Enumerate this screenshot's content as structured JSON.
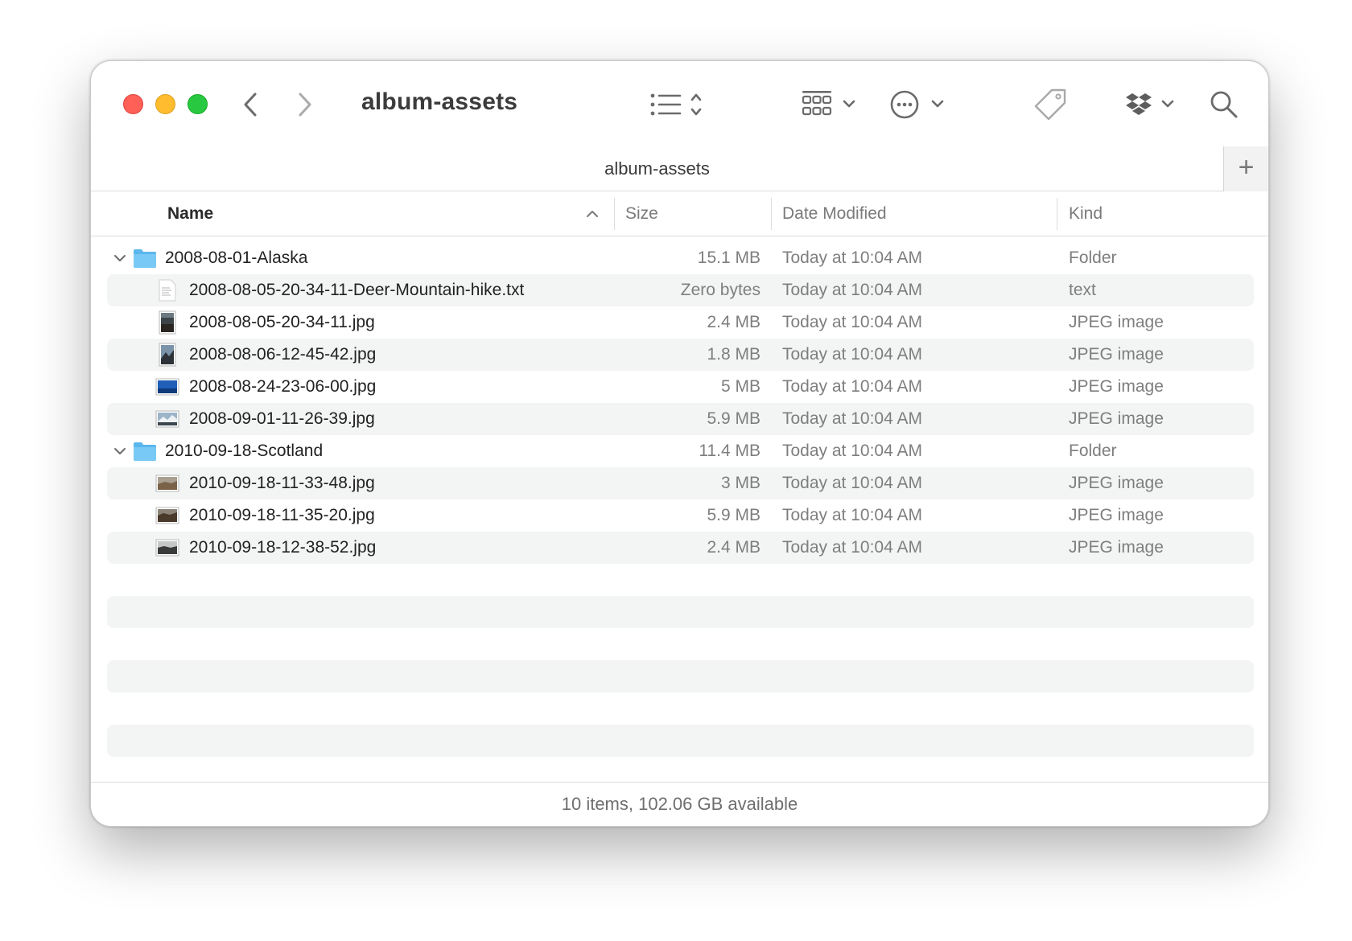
{
  "window": {
    "title": "album-assets",
    "path_title": "album-assets",
    "add_button": "+"
  },
  "toolbar": {
    "back_icon": "chevron-left-icon",
    "forward_icon": "chevron-right-icon",
    "view_icon": "list-view-icon",
    "group_icon": "grid-group-icon",
    "action_icon": "ellipsis-circle-icon",
    "tag_icon": "tag-icon",
    "dropbox_icon": "dropbox-icon",
    "search_icon": "magnifying-glass-icon"
  },
  "columns": {
    "name": "Name",
    "size": "Size",
    "date": "Date Modified",
    "kind": "Kind"
  },
  "rows": [
    {
      "name": "2008-08-01-Alaska",
      "size": "15.1 MB",
      "date": "Today at 10:04 AM",
      "kind": "Folder",
      "type": "folder",
      "level": 0
    },
    {
      "name": "2008-08-05-20-34-11-Deer-Mountain-hike.txt",
      "size": "Zero bytes",
      "date": "Today at 10:04 AM",
      "kind": "text",
      "type": "text",
      "level": 1
    },
    {
      "name": "2008-08-05-20-34-11.jpg",
      "size": "2.4 MB",
      "date": "Today at 10:04 AM",
      "kind": "JPEG image",
      "type": "jpg-portrait-dark",
      "level": 1
    },
    {
      "name": "2008-08-06-12-45-42.jpg",
      "size": "1.8 MB",
      "date": "Today at 10:04 AM",
      "kind": "JPEG image",
      "type": "jpg-portrait-mountain",
      "level": 1
    },
    {
      "name": "2008-08-24-23-06-00.jpg",
      "size": "5 MB",
      "date": "Today at 10:04 AM",
      "kind": "JPEG image",
      "type": "jpg-landscape-blue",
      "level": 1
    },
    {
      "name": "2008-09-01-11-26-39.jpg",
      "size": "5.9 MB",
      "date": "Today at 10:04 AM",
      "kind": "JPEG image",
      "type": "jpg-landscape-snow",
      "level": 1
    },
    {
      "name": "2010-09-18-Scotland",
      "size": "11.4 MB",
      "date": "Today at 10:04 AM",
      "kind": "Folder",
      "type": "folder",
      "level": 0
    },
    {
      "name": "2010-09-18-11-33-48.jpg",
      "size": "3 MB",
      "date": "Today at 10:04 AM",
      "kind": "JPEG image",
      "type": "jpg-landscape-brown",
      "level": 1
    },
    {
      "name": "2010-09-18-11-35-20.jpg",
      "size": "5.9 MB",
      "date": "Today at 10:04 AM",
      "kind": "JPEG image",
      "type": "jpg-landscape-dark",
      "level": 1
    },
    {
      "name": "2010-09-18-12-38-52.jpg",
      "size": "2.4 MB",
      "date": "Today at 10:04 AM",
      "kind": "JPEG image",
      "type": "jpg-landscape-grey",
      "level": 1
    }
  ],
  "status": {
    "text": "10 items, 102.06 GB available"
  },
  "colors": {
    "close": "#fe5f57",
    "minimize": "#febc2e",
    "zoom": "#28c840",
    "folder": "#6cc4f3",
    "row_alt": "#f3f4f4"
  }
}
